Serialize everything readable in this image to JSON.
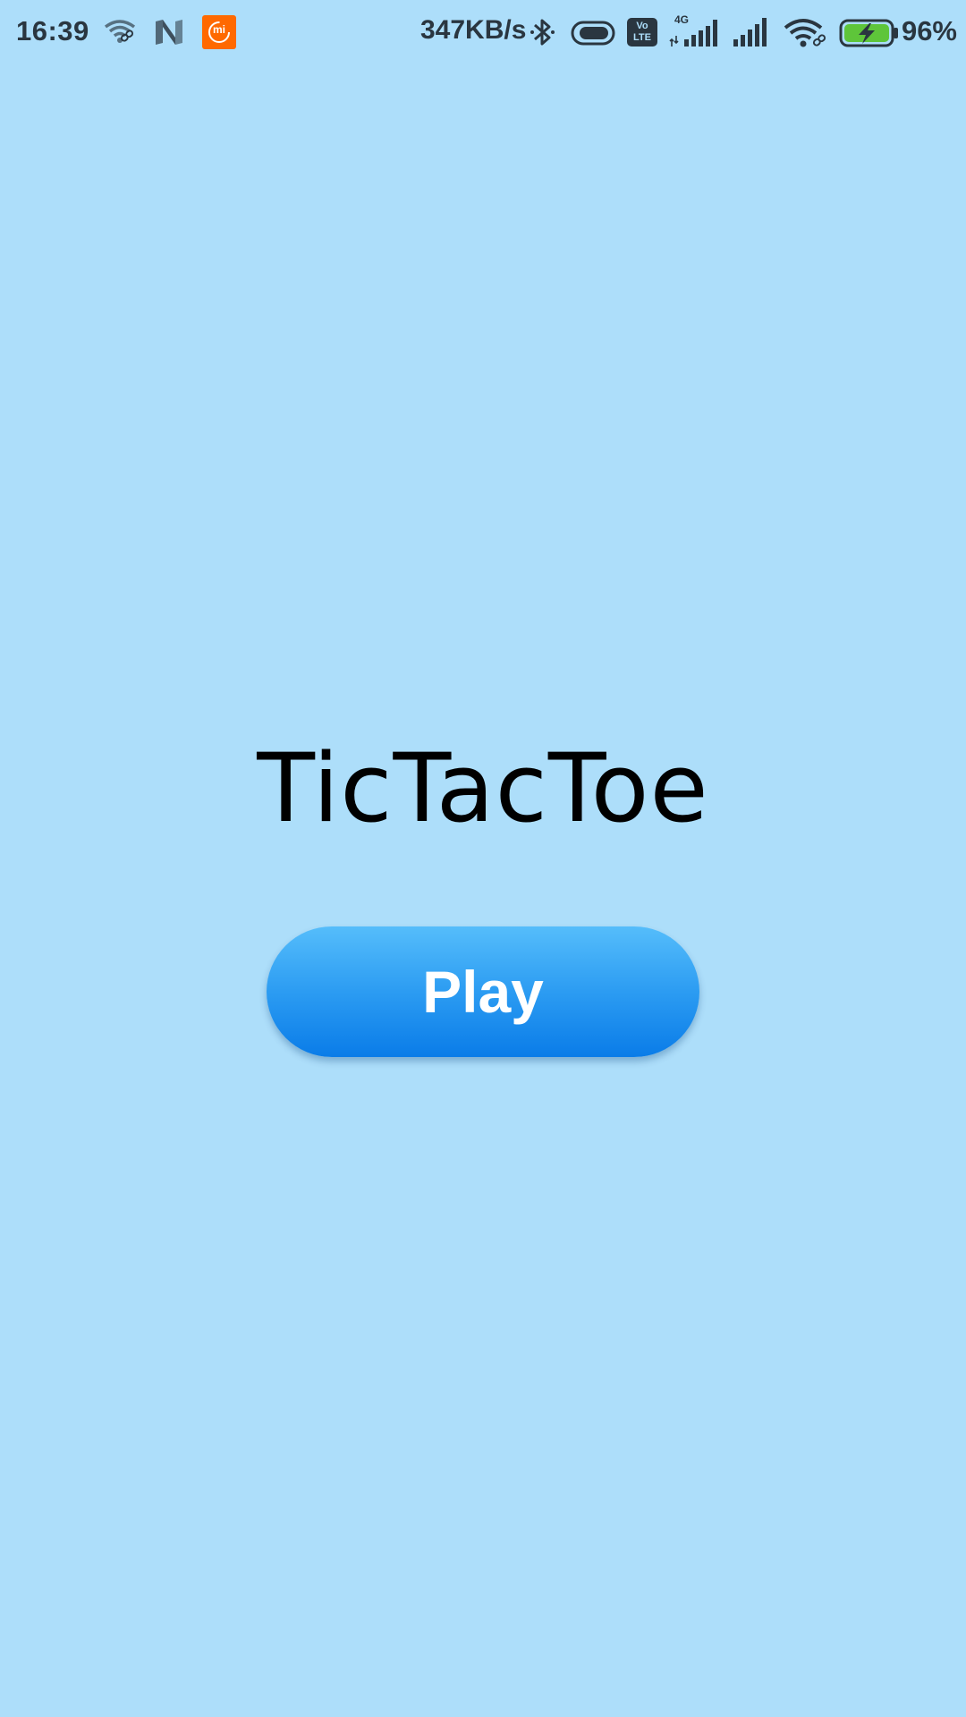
{
  "status_bar": {
    "time": "16:39",
    "network_speed": "347KB/s",
    "battery_percent": "96%",
    "battery_level": 0.96,
    "battery_charging": true,
    "mi_badge_text": "mi",
    "volte_top": "Vo",
    "volte_bottom": "LTE",
    "network_type": "4G",
    "icons": [
      "wifi-link-icon",
      "n-notification-icon",
      "mi-app-icon",
      "bluetooth-icon",
      "toggle-icon",
      "volte-icon",
      "signal-4g-icon",
      "signal-icon",
      "wifi-icon",
      "battery-charging-icon"
    ]
  },
  "main": {
    "title": "TicTacToe",
    "play_label": "Play"
  },
  "colors": {
    "background": "#addefa",
    "button_top": "#55bdfb",
    "button_bottom": "#0a7ce8",
    "title_text": "#000000",
    "status_text": "#2a3640",
    "battery_fill": "#5ec53a",
    "mi_orange": "#ff6900"
  }
}
